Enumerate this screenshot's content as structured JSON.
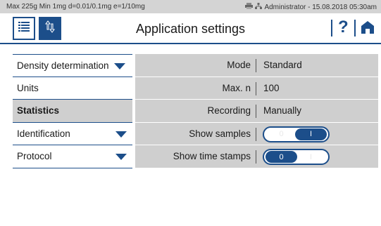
{
  "statusbar": {
    "left_text": "Max 225g  Min 1mg  d=0.01/0.1mg  e=1/10mg",
    "printer_icon": "printer-icon",
    "network_icon": "network-icon",
    "user_text": "Administrator  -  15.08.2018 05:30am"
  },
  "header": {
    "title": "Application settings",
    "menu_icon": "list-icon",
    "transfer_icon": "transfer-arrows-icon",
    "help_label": "?",
    "home_icon": "home-icon"
  },
  "leftnav": {
    "items": [
      {
        "label": "Density determination",
        "has_arrow": true,
        "active": false
      },
      {
        "label": "Units",
        "has_arrow": false,
        "active": false
      },
      {
        "label": "Statistics",
        "has_arrow": false,
        "active": true
      },
      {
        "label": "Identification",
        "has_arrow": true,
        "active": false
      },
      {
        "label": "Protocol",
        "has_arrow": true,
        "active": false
      }
    ]
  },
  "settings": {
    "rows": [
      {
        "label": "Mode",
        "value": "Standard"
      },
      {
        "label": "Max. n",
        "value": "100"
      },
      {
        "label": "Recording",
        "value": "Manually"
      },
      {
        "label": "Show samples",
        "toggle": {
          "off_label": "0",
          "on_label": "I",
          "state": "on"
        }
      },
      {
        "label": "Show time stamps",
        "toggle": {
          "off_label": "0",
          "on_label": "I",
          "state": "off"
        }
      }
    ]
  },
  "colors": {
    "accent": "#1c4e8a",
    "panel_bg": "#cfcfcf",
    "statusbar_bg": "#d4d4d4"
  }
}
